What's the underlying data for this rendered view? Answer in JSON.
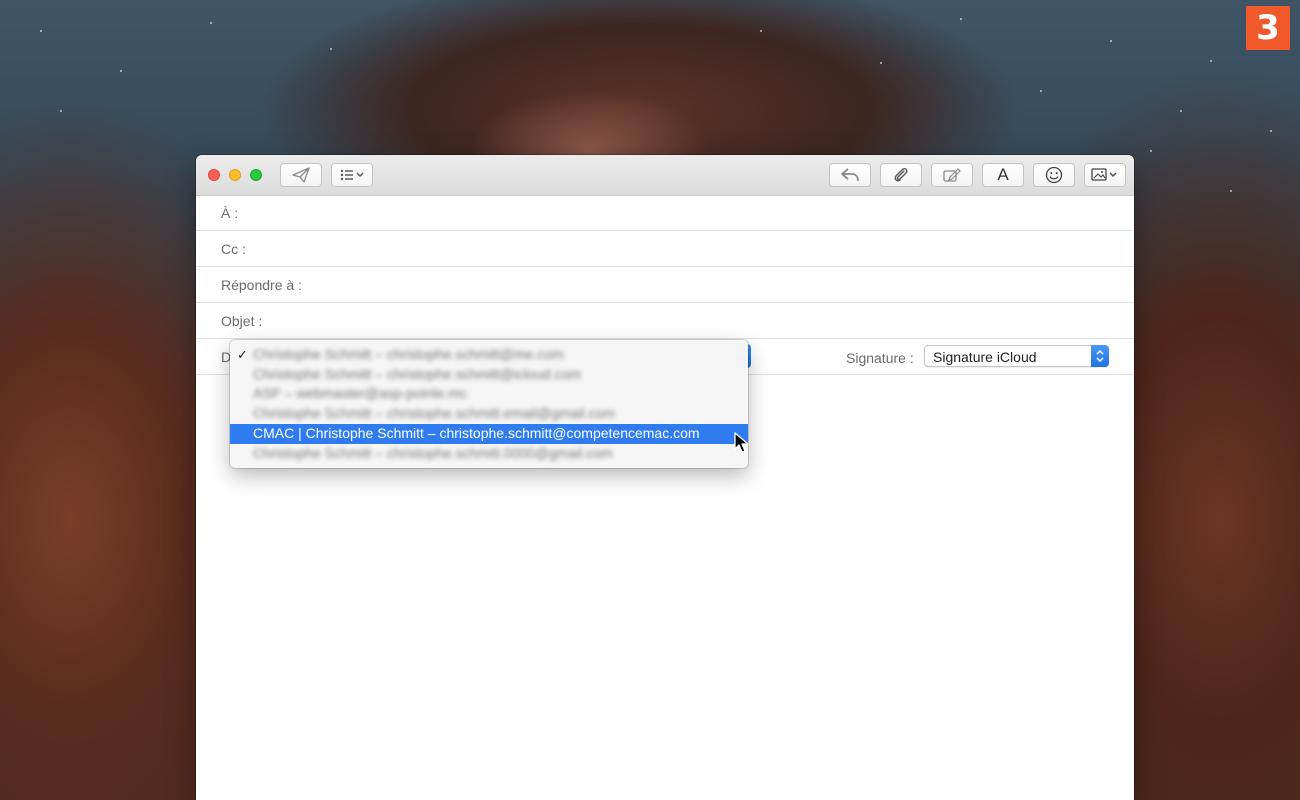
{
  "step_badge": "3",
  "compose": {
    "fields": [
      {
        "label": "À :",
        "value": ""
      },
      {
        "label": "Cc :",
        "value": ""
      },
      {
        "label": "Répondre à :",
        "value": ""
      },
      {
        "label": "Objet :",
        "value": ""
      }
    ],
    "from_label": "D",
    "signature_label": "Signature :",
    "signature_value": "Signature iCloud"
  },
  "toolbar": {
    "font_label": "A"
  },
  "from_menu": {
    "items": [
      {
        "text": "Christophe Schmitt – christophe.schmitt@me.com",
        "checked": true,
        "blurred": true,
        "selected": false
      },
      {
        "text": "Christophe Schmitt – christophe.schmitt@icloud.com",
        "checked": false,
        "blurred": true,
        "selected": false
      },
      {
        "text": "ASP – webmaster@asp-pointe.mc",
        "checked": false,
        "blurred": true,
        "selected": false
      },
      {
        "text": "Christophe Schmitt – christophe.schmitt.email@gmail.com",
        "checked": false,
        "blurred": true,
        "selected": false
      },
      {
        "text": "CMAC | Christophe Schmitt – christophe.schmitt@competencemac.com",
        "checked": false,
        "blurred": false,
        "selected": true
      },
      {
        "text": "Christophe Schmitt – christophe.schmitt.0000@gmail.com",
        "checked": false,
        "blurred": true,
        "selected": false
      }
    ],
    "checkmark": "✓"
  }
}
